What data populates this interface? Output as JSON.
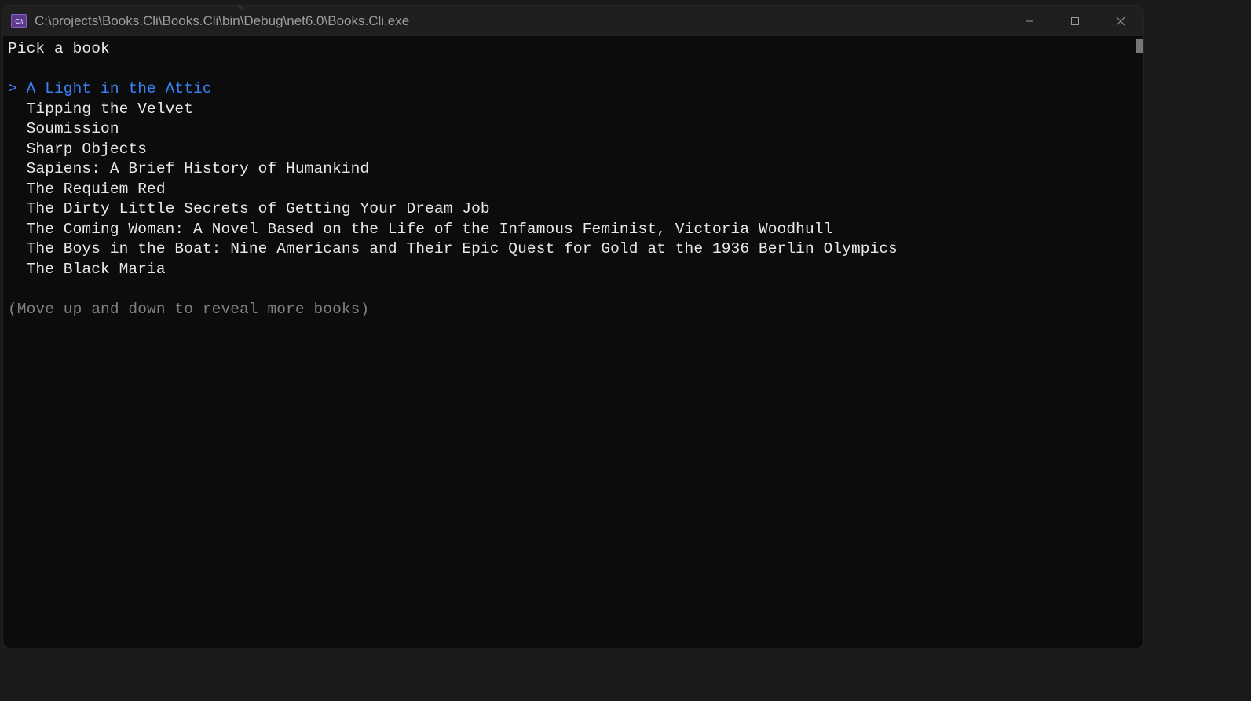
{
  "titlebar": {
    "icon_text": "C:\\",
    "path": "C:\\projects\\Books.Cli\\Books.Cli\\bin\\Debug\\net6.0\\Books.Cli.exe"
  },
  "window_controls": {
    "minimize": "minimize",
    "maximize": "maximize",
    "close": "close"
  },
  "terminal": {
    "prompt": "Pick a book",
    "selected_indicator": "> ",
    "indent": "  ",
    "books": [
      {
        "title": "A Light in the Attic",
        "selected": true
      },
      {
        "title": "Tipping the Velvet",
        "selected": false
      },
      {
        "title": "Soumission",
        "selected": false
      },
      {
        "title": "Sharp Objects",
        "selected": false
      },
      {
        "title": "Sapiens: A Brief History of Humankind",
        "selected": false
      },
      {
        "title": "The Requiem Red",
        "selected": false
      },
      {
        "title": "The Dirty Little Secrets of Getting Your Dream Job",
        "selected": false
      },
      {
        "title": "The Coming Woman: A Novel Based on the Life of the Infamous Feminist, Victoria Woodhull",
        "selected": false
      },
      {
        "title": "The Boys in the Boat: Nine Americans and Their Epic Quest for Gold at the 1936 Berlin Olympics",
        "selected": false
      },
      {
        "title": "The Black Maria",
        "selected": false
      }
    ],
    "hint": "(Move up and down to reveal more books)"
  },
  "colors": {
    "window_bg": "#0c0c0c",
    "titlebar_bg": "#1f1f1f",
    "titlebar_fg": "#9d9d9d",
    "text": "#e8e8e8",
    "selected": "#3b82f6",
    "hint": "#808080"
  }
}
